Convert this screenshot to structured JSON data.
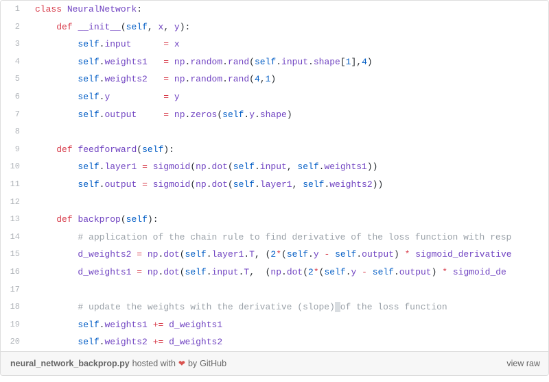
{
  "lines": [
    {
      "n": 1,
      "html": "<span class='kw'>class</span> <span class='fn'>NeuralNetwork</span>:"
    },
    {
      "n": 2,
      "html": "    <span class='kw'>def</span> <span class='fn'>__init__</span>(<span class='self'>self</span>, <span class='fn'>x</span>, <span class='fn'>y</span>):"
    },
    {
      "n": 3,
      "html": "        <span class='self'>self</span>.<span class='fn'>input</span>      <span class='op'>=</span> <span class='fn'>x</span>"
    },
    {
      "n": 4,
      "html": "        <span class='self'>self</span>.<span class='fn'>weights1</span>   <span class='op'>=</span> <span class='fn'>np</span>.<span class='fn'>random</span>.<span class='fn'>rand</span>(<span class='self'>self</span>.<span class='fn'>input</span>.<span class='fn'>shape</span>[<span class='num'>1</span>],<span class='num'>4</span>)"
    },
    {
      "n": 5,
      "html": "        <span class='self'>self</span>.<span class='fn'>weights2</span>   <span class='op'>=</span> <span class='fn'>np</span>.<span class='fn'>random</span>.<span class='fn'>rand</span>(<span class='num'>4</span>,<span class='num'>1</span>)"
    },
    {
      "n": 6,
      "html": "        <span class='self'>self</span>.<span class='fn'>y</span>          <span class='op'>=</span> <span class='fn'>y</span>"
    },
    {
      "n": 7,
      "html": "        <span class='self'>self</span>.<span class='fn'>output</span>     <span class='op'>=</span> <span class='fn'>np</span>.<span class='fn'>zeros</span>(<span class='self'>self</span>.<span class='fn'>y</span>.<span class='fn'>shape</span>)"
    },
    {
      "n": 8,
      "html": ""
    },
    {
      "n": 9,
      "html": "    <span class='kw'>def</span> <span class='fn'>feedforward</span>(<span class='self'>self</span>):"
    },
    {
      "n": 10,
      "html": "        <span class='self'>self</span>.<span class='fn'>layer1</span> <span class='op'>=</span> <span class='fn'>sigmoid</span>(<span class='fn'>np</span>.<span class='fn'>dot</span>(<span class='self'>self</span>.<span class='fn'>input</span>, <span class='self'>self</span>.<span class='fn'>weights1</span>))"
    },
    {
      "n": 11,
      "html": "        <span class='self'>self</span>.<span class='fn'>output</span> <span class='op'>=</span> <span class='fn'>sigmoid</span>(<span class='fn'>np</span>.<span class='fn'>dot</span>(<span class='self'>self</span>.<span class='fn'>layer1</span>, <span class='self'>self</span>.<span class='fn'>weights2</span>))"
    },
    {
      "n": 12,
      "html": ""
    },
    {
      "n": 13,
      "html": "    <span class='kw'>def</span> <span class='fn'>backprop</span>(<span class='self'>self</span>):"
    },
    {
      "n": 14,
      "html": "        <span class='cmt'># application of the chain rule to find derivative of the loss function with resp</span>"
    },
    {
      "n": 15,
      "html": "        <span class='fn'>d_weights2</span> <span class='op'>=</span> <span class='fn'>np</span>.<span class='fn'>dot</span>(<span class='self'>self</span>.<span class='fn'>layer1</span>.<span class='fn'>T</span>, (<span class='num'>2</span><span class='op'>*</span>(<span class='self'>self</span>.<span class='fn'>y</span> <span class='op'>-</span> <span class='self'>self</span>.<span class='fn'>output</span>) <span class='op'>*</span> <span class='fn'>sigmoid_derivative</span>"
    },
    {
      "n": 16,
      "html": "        <span class='fn'>d_weights1</span> <span class='op'>=</span> <span class='fn'>np</span>.<span class='fn'>dot</span>(<span class='self'>self</span>.<span class='fn'>input</span>.<span class='fn'>T</span>,  (<span class='fn'>np</span>.<span class='fn'>dot</span>(<span class='num'>2</span><span class='op'>*</span>(<span class='self'>self</span>.<span class='fn'>y</span> <span class='op'>-</span> <span class='self'>self</span>.<span class='fn'>output</span>) <span class='op'>*</span> <span class='fn'>sigmoid_de</span>"
    },
    {
      "n": 17,
      "html": ""
    },
    {
      "n": 18,
      "html": "        <span class='cmt'># update the weights with the derivative (slope)<span class='hl'> </span>of the loss function</span>"
    },
    {
      "n": 19,
      "html": "        <span class='self'>self</span>.<span class='fn'>weights1</span> <span class='op'>+=</span> <span class='fn'>d_weights1</span>"
    },
    {
      "n": 20,
      "html": "        <span class='self'>self</span>.<span class='fn'>weights2</span> <span class='op'>+=</span> <span class='fn'>d_weights2</span>"
    }
  ],
  "meta": {
    "filename": "neural_network_backprop.py",
    "hosted_with": "hosted with",
    "heart": "❤",
    "by": "by",
    "host": "GitHub",
    "view_raw": "view raw"
  }
}
